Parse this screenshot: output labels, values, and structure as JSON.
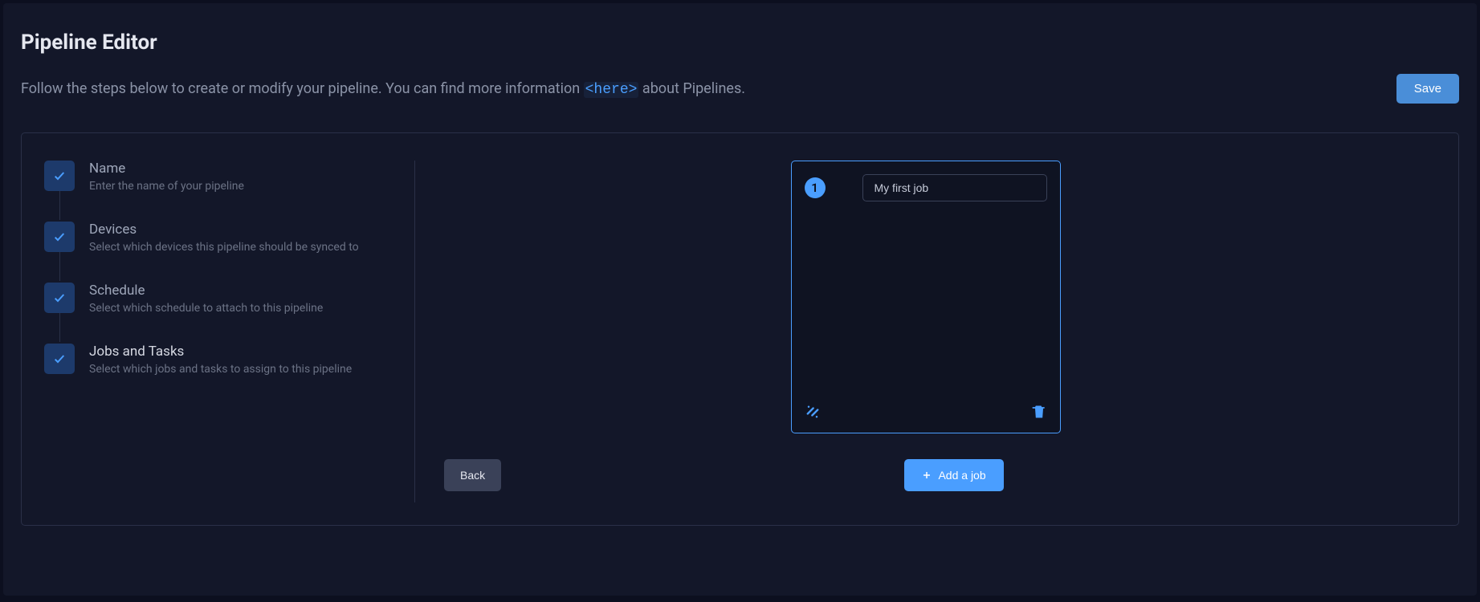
{
  "page": {
    "title": "Pipeline Editor",
    "subtitle_before": "Follow the steps below to create or modify your pipeline. You can find more information ",
    "subtitle_link": "<here>",
    "subtitle_after": " about Pipelines."
  },
  "buttons": {
    "save": "Save",
    "back": "Back",
    "add_job": "Add a job"
  },
  "steps": [
    {
      "title": "Name",
      "description": "Enter the name of your pipeline",
      "completed": true,
      "active": false
    },
    {
      "title": "Devices",
      "description": "Select which devices this pipeline should be synced to",
      "completed": true,
      "active": false
    },
    {
      "title": "Schedule",
      "description": "Select which schedule to attach to this pipeline",
      "completed": true,
      "active": false
    },
    {
      "title": "Jobs and Tasks",
      "description": "Select which jobs and tasks to assign to this pipeline",
      "completed": true,
      "active": true
    }
  ],
  "job": {
    "number": "1",
    "name": "My first job"
  }
}
